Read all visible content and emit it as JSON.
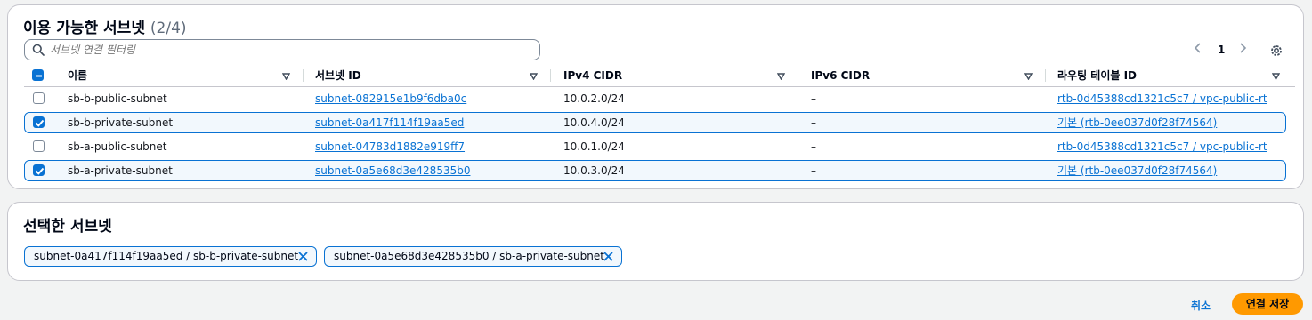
{
  "available": {
    "title": "이용 가능한 서브넷",
    "count": "(2/4)",
    "filter_placeholder": "서브넷 연결 필터링",
    "pagination": {
      "page": "1"
    },
    "columns": [
      "이름",
      "서브넷 ID",
      "IPv4 CIDR",
      "IPv6 CIDR",
      "라우팅 테이블 ID"
    ],
    "rows": [
      {
        "selected": false,
        "name": "sb-b-public-subnet",
        "subnet_id": "subnet-082915e1b9f6dba0c",
        "ipv4": "10.0.2.0/24",
        "ipv6": "–",
        "route_table": "rtb-0d45388cd1321c5c7 / vpc-public-rt"
      },
      {
        "selected": true,
        "name": "sb-b-private-subnet",
        "subnet_id": "subnet-0a417f114f19aa5ed",
        "ipv4": "10.0.4.0/24",
        "ipv6": "–",
        "route_table": "기본 (rtb-0ee037d0f28f74564)"
      },
      {
        "selected": false,
        "name": "sb-a-public-subnet",
        "subnet_id": "subnet-04783d1882e919ff7",
        "ipv4": "10.0.1.0/24",
        "ipv6": "–",
        "route_table": "rtb-0d45388cd1321c5c7 / vpc-public-rt"
      },
      {
        "selected": true,
        "name": "sb-a-private-subnet",
        "subnet_id": "subnet-0a5e68d3e428535b0",
        "ipv4": "10.0.3.0/24",
        "ipv6": "–",
        "route_table": "기본 (rtb-0ee037d0f28f74564)"
      }
    ]
  },
  "selected_section": {
    "title": "선택한 서브넷",
    "tokens": [
      "subnet-0a417f114f19aa5ed / sb-b-private-subnet",
      "subnet-0a5e68d3e428535b0 / sb-a-private-subnet"
    ]
  },
  "actions": {
    "cancel": "취소",
    "save": "연결 저장"
  },
  "colors": {
    "accent": "#0972d3",
    "primary_button": "#ff9900",
    "selected_row_bg": "#f2f8fd"
  },
  "icons": [
    "search-icon",
    "chevron-left-icon",
    "chevron-right-icon",
    "gear-icon",
    "sort-caret-icon",
    "checkbox-icon",
    "close-icon"
  ]
}
